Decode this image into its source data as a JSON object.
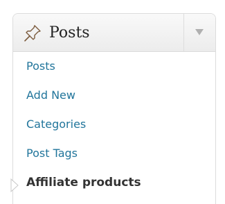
{
  "menu": {
    "title": "Posts",
    "icon": "pushpin-icon",
    "toggle_icon": "chevron-down-icon",
    "items": [
      {
        "label": "Posts",
        "current": false
      },
      {
        "label": "Add New",
        "current": false
      },
      {
        "label": "Categories",
        "current": false
      },
      {
        "label": "Post Tags",
        "current": false
      },
      {
        "label": "Affiliate products",
        "current": true
      }
    ]
  },
  "colors": {
    "link": "#21759b",
    "current_text": "#333333",
    "header_bg": "#ececec",
    "border": "#dcdcdc"
  }
}
